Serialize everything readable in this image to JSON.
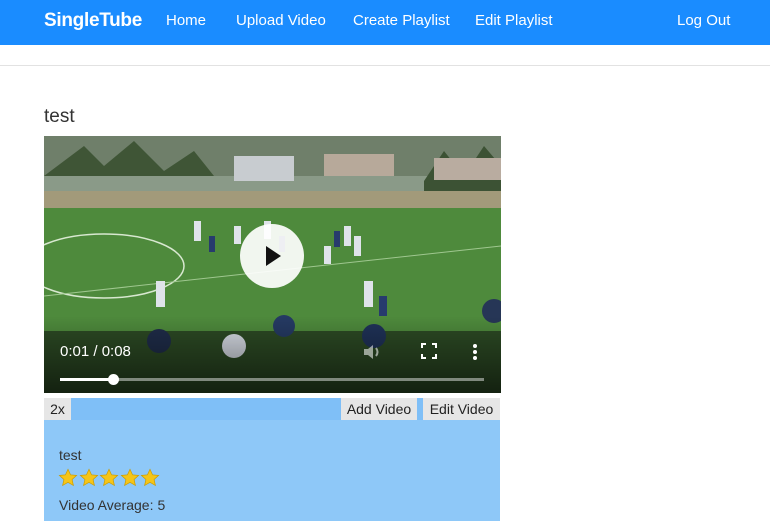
{
  "nav": {
    "brand": "SingleTube",
    "links": [
      "Home",
      "Upload Video",
      "Create Playlist",
      "Edit Playlist"
    ],
    "logout": "Log Out"
  },
  "video": {
    "title": "test",
    "current_time": "0:01",
    "duration": "0:08",
    "time_display": "0:01 / 0:08",
    "progress": 0.125
  },
  "toolbar": {
    "speed": "2x",
    "add_video": "Add Video",
    "edit_video": "Edit Video"
  },
  "info": {
    "title": "test",
    "rating": 5,
    "rating_max": 5,
    "average_label": "Video Average:",
    "average_value": "5"
  },
  "icons": [
    "play-icon",
    "volume-icon",
    "fullscreen-icon",
    "more-options-icon",
    "star-icon"
  ],
  "colors": {
    "navbar": "#1a8cff",
    "toolbar": "#7fbff7",
    "panel": "#8ec8f8",
    "star": "#f5c518"
  }
}
